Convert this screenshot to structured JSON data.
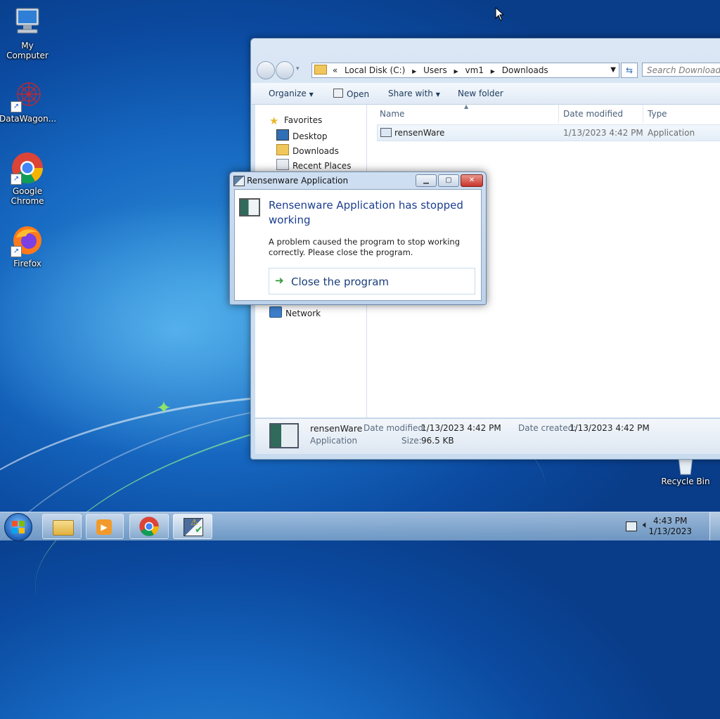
{
  "desktop": {
    "icons": [
      {
        "label": "My Computer"
      },
      {
        "label": "DataWagon..."
      },
      {
        "label": "Google Chrome"
      },
      {
        "label": "Firefox"
      },
      {
        "label": "Recycle Bin"
      }
    ]
  },
  "explorer": {
    "breadcrumb": {
      "overflow": "«",
      "segments": [
        "Local Disk (C:)",
        "Users",
        "vm1",
        "Downloads"
      ]
    },
    "search_placeholder": "Search Downloads",
    "toolbar": {
      "organize": "Organize",
      "open": "Open",
      "share_with": "Share with",
      "new_folder": "New folder"
    },
    "nav": {
      "favorites": "Favorites",
      "desktop": "Desktop",
      "downloads": "Downloads",
      "recent_places": "Recent Places",
      "network": "Network"
    },
    "columns": {
      "name": "Name",
      "date_modified": "Date modified",
      "type": "Type"
    },
    "files": [
      {
        "name": "rensenWare",
        "date_modified": "1/13/2023 4:42 PM",
        "type": "Application"
      }
    ],
    "details": {
      "name": "rensenWare",
      "type": "Application",
      "date_modified_label": "Date modified:",
      "date_modified": "1/13/2023 4:42 PM",
      "size_label": "Size:",
      "size": "96.5 KB",
      "date_created_label": "Date created:",
      "date_created": "1/13/2023 4:42 PM"
    }
  },
  "dialog": {
    "title": "Rensenware Application",
    "heading": "Rensenware Application has stopped working",
    "message": "A problem caused the program to stop working correctly. Please close the program.",
    "command": "Close the program"
  },
  "taskbar": {
    "time": "4:43 PM",
    "date": "1/13/2023"
  },
  "colors": {
    "desktop_blue": "#1667c0",
    "dialog_heading": "#1b3d8f",
    "close_red": "#c8342a"
  }
}
